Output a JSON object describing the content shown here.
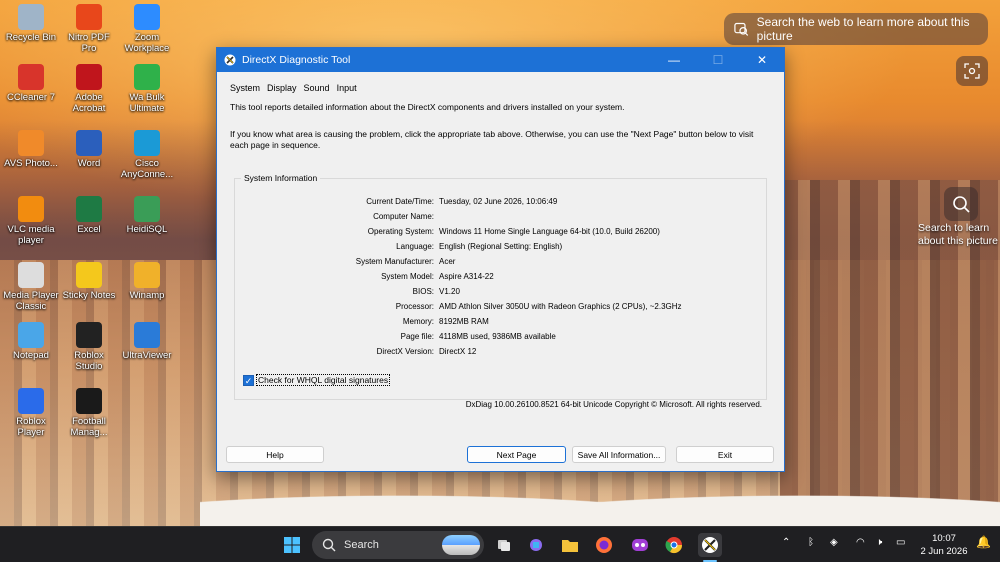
{
  "desktop": {
    "icons": [
      {
        "label": "Recycle Bin",
        "icon": "recycle-bin-icon",
        "color": "#9fb4c8"
      },
      {
        "label": "Nitro PDF Pro",
        "icon": "nitro-pdf-icon",
        "color": "#e8471b"
      },
      {
        "label": "Zoom Workplace",
        "icon": "zoom-icon",
        "color": "#2d8cff"
      },
      {
        "label": "CCleaner 7",
        "icon": "ccleaner-icon",
        "color": "#d8342b"
      },
      {
        "label": "Adobe Acrobat",
        "icon": "acrobat-icon",
        "color": "#c0151c"
      },
      {
        "label": "Wa Bulk Ultimate",
        "icon": "wa-bulk-icon",
        "color": "#2fb14a"
      },
      {
        "label": "AVS Photo...",
        "icon": "avs-photo-icon",
        "color": "#f08a2a"
      },
      {
        "label": "Word",
        "icon": "word-icon",
        "color": "#2b5fbc"
      },
      {
        "label": "Cisco AnyConne...",
        "icon": "cisco-icon",
        "color": "#1b9ad6"
      },
      {
        "label": "VLC media player",
        "icon": "vlc-icon",
        "color": "#f28c0f"
      },
      {
        "label": "Excel",
        "icon": "excel-icon",
        "color": "#1e7a44"
      },
      {
        "label": "HeidiSQL",
        "icon": "heidisql-icon",
        "color": "#3a9d57"
      },
      {
        "label": "Media Player Classic",
        "icon": "media-player-classic-icon",
        "color": "#dddddd"
      },
      {
        "label": "Sticky Notes",
        "icon": "sticky-notes-icon",
        "color": "#f4c81c"
      },
      {
        "label": "Winamp",
        "icon": "winamp-icon",
        "color": "#f0b12a"
      },
      {
        "label": "Notepad",
        "icon": "notepad-icon",
        "color": "#4aa6e8"
      },
      {
        "label": "Roblox Studio",
        "icon": "roblox-studio-icon",
        "color": "#222222"
      },
      {
        "label": "UltraViewer",
        "icon": "ultraviewer-icon",
        "color": "#2a7bd8"
      },
      {
        "label": "Roblox Player",
        "icon": "roblox-player-icon",
        "color": "#2a6bea"
      },
      {
        "label": "Football Manag...",
        "icon": "football-manager-icon",
        "color": "#1a1a1a"
      }
    ]
  },
  "copilot": {
    "search_pill": "Search the web to learn more about this picture",
    "side_text_line1": "Search to learn",
    "side_text_line2": "about this picture"
  },
  "dxdiag": {
    "title": "DirectX Diagnostic Tool",
    "tabs": [
      "System",
      "Display",
      "Sound",
      "Input"
    ],
    "intro": "This tool reports detailed information about the DirectX components and drivers installed on your system.",
    "intro2": "If you know what area is causing the problem, click the appropriate tab above.  Otherwise, you can use the \"Next Page\" button below to visit each page in sequence.",
    "group_title": "System Information",
    "rows": [
      {
        "k": "Current Date/Time:",
        "v": "Tuesday, 02 June 2026, 10:06:49"
      },
      {
        "k": "Computer Name:",
        "v": ""
      },
      {
        "k": "Operating System:",
        "v": "Windows 11 Home Single Language 64-bit (10.0, Build 26200)"
      },
      {
        "k": "Language:",
        "v": "English (Regional Setting: English)"
      },
      {
        "k": "System Manufacturer:",
        "v": "Acer"
      },
      {
        "k": "System Model:",
        "v": "Aspire A314-22"
      },
      {
        "k": "BIOS:",
        "v": "V1.20"
      },
      {
        "k": "Processor:",
        "v": "AMD Athlon Silver 3050U with Radeon Graphics     (2 CPUs), ~2.3GHz"
      },
      {
        "k": "Memory:",
        "v": "8192MB RAM"
      },
      {
        "k": "Page file:",
        "v": "4118MB used, 9386MB available"
      },
      {
        "k": "DirectX Version:",
        "v": "DirectX 12"
      }
    ],
    "checkbox_label": "Check for WHQL digital signatures",
    "checkbox_checked": true,
    "footer": "DxDiag 10.00.26100.8521 64-bit Unicode  Copyright © Microsoft. All rights reserved.",
    "buttons": {
      "help": "Help",
      "next": "Next Page",
      "save": "Save All Information...",
      "exit": "Exit"
    }
  },
  "taskbar": {
    "search_label": "Search",
    "clock_time": "10:07",
    "clock_date": "2 Jun 2026",
    "accent": "#1d71d6"
  }
}
